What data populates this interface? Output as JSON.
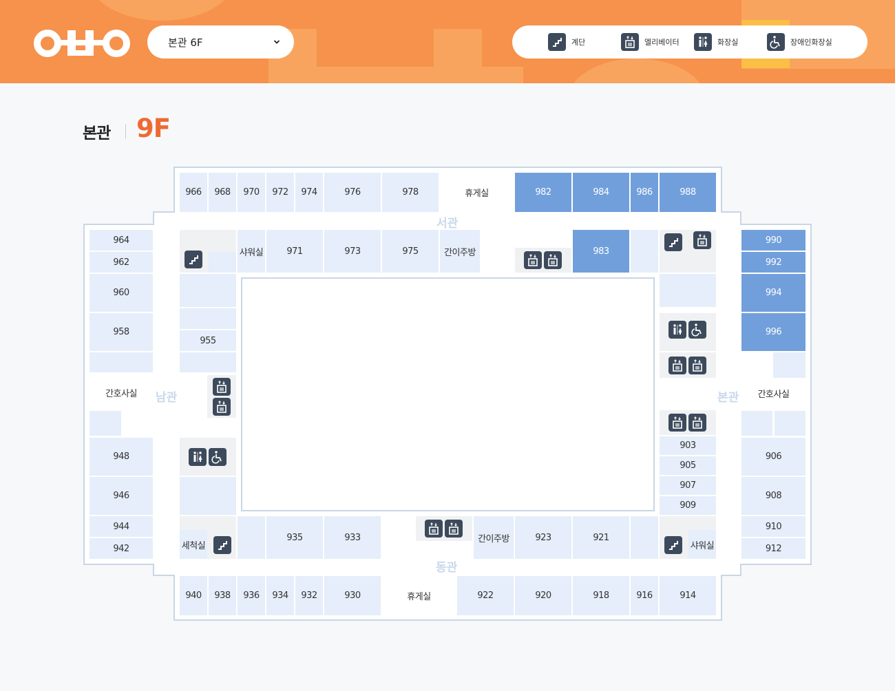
{
  "header": {
    "floor_select": {
      "value": "본관 6F"
    },
    "legend": [
      {
        "icon": "stairs-icon",
        "label": "계단"
      },
      {
        "icon": "elevator-icon",
        "label": "엘리베이터"
      },
      {
        "icon": "restroom-icon",
        "label": "화장실"
      },
      {
        "icon": "accessible-restroom-icon",
        "label": "장애인화장실"
      }
    ]
  },
  "title": {
    "building": "본관",
    "floor": "9F"
  },
  "wings": {
    "north": "서관",
    "south": "동관",
    "west": "남관",
    "east": "본관"
  },
  "rooms": {
    "r966": "966",
    "r968": "968",
    "r970": "970",
    "r972": "972",
    "r974": "974",
    "r976": "976",
    "r978": "978",
    "lounge_top": "휴게실",
    "r982": "982",
    "r984": "984",
    "r986": "986",
    "r988": "988",
    "r964": "964",
    "r962": "962",
    "r960": "960",
    "r958": "958",
    "nurse_left": "간호사실",
    "r948": "948",
    "r946": "946",
    "r944": "944",
    "r942": "942",
    "shower_top": "샤워실",
    "r971": "971",
    "r973": "973",
    "r975": "975",
    "kitchen_top": "간이주방",
    "r983": "983",
    "r955": "955",
    "r990": "990",
    "r992": "992",
    "r994": "994",
    "r996": "996",
    "nurse_right": "간호사실",
    "r906": "906",
    "r908": "908",
    "r910": "910",
    "r912": "912",
    "r903": "903",
    "r905": "905",
    "r907": "907",
    "r909": "909",
    "wash": "세척실",
    "r935": "935",
    "r933": "933",
    "kitchen_bottom": "간이주방",
    "r923": "923",
    "r921": "921",
    "shower_bottom": "샤워실",
    "r940": "940",
    "r938": "938",
    "r936": "936",
    "r934": "934",
    "r932": "932",
    "r930": "930",
    "lounge_bottom": "휴게실",
    "r922": "922",
    "r920": "920",
    "r918": "918",
    "r916": "916",
    "r914": "914"
  },
  "colors": {
    "header": "#f6924b",
    "accent": "#ee6a33",
    "room_light": "#e5eefa",
    "room_dark": "#719fdb",
    "icon_bg": "#3c4a5c"
  }
}
